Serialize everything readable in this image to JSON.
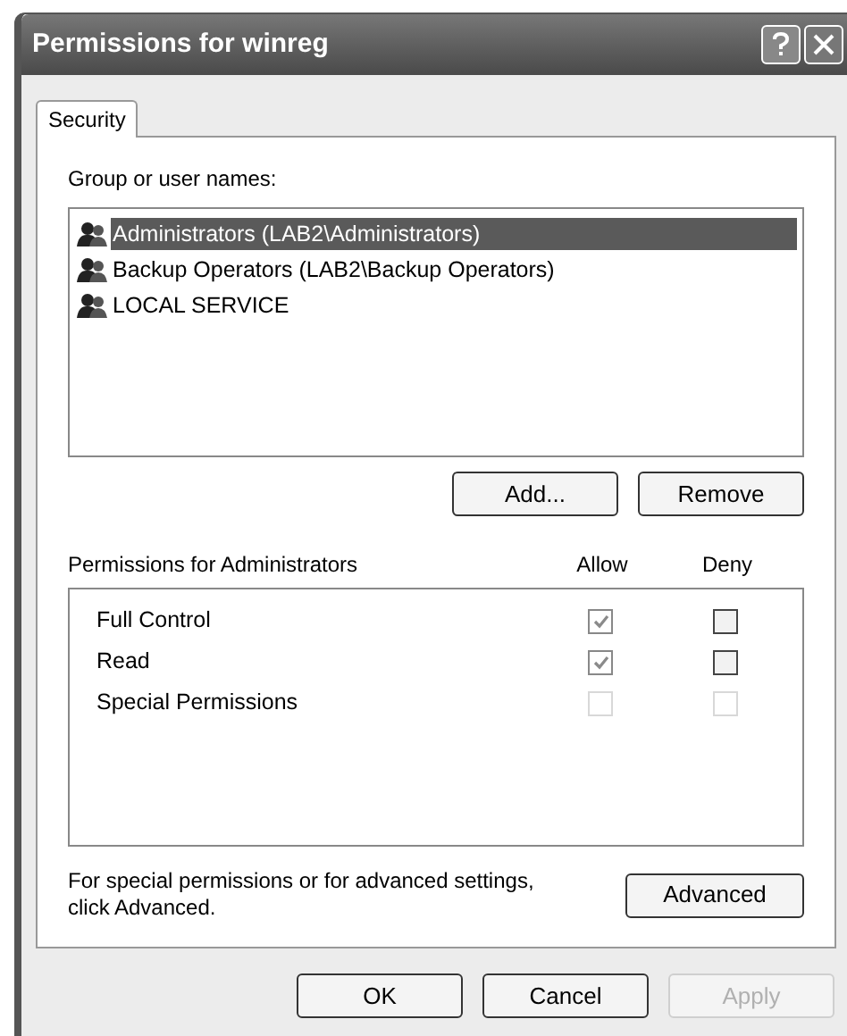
{
  "window": {
    "title": "Permissions for winreg"
  },
  "tabs": [
    {
      "label": "Security",
      "selected": true
    }
  ],
  "group_label": "Group or user names:",
  "users": [
    {
      "name": "Administrators (LAB2\\Administrators)",
      "selected": true
    },
    {
      "name": "Backup Operators (LAB2\\Backup Operators)",
      "selected": false
    },
    {
      "name": "LOCAL SERVICE",
      "selected": false
    }
  ],
  "user_buttons": [
    "Add...",
    "Remove"
  ],
  "permissions": {
    "title": "Permissions for Administrators",
    "columns": [
      "Allow",
      "Deny"
    ],
    "rows": [
      {
        "name": "Full Control",
        "allow": {
          "checked": true,
          "disabled": true
        },
        "deny": {
          "checked": false,
          "disabled": false
        }
      },
      {
        "name": "Read",
        "allow": {
          "checked": true,
          "disabled": true
        },
        "deny": {
          "checked": false,
          "disabled": false
        }
      },
      {
        "name": "Special Permissions",
        "allow": {
          "checked": false,
          "disabled": true
        },
        "deny": {
          "checked": false,
          "disabled": true
        }
      }
    ]
  },
  "advanced_note": "For special permissions or for advanced settings, click Advanced.",
  "advanced_button": "Advanced",
  "buttons": [
    {
      "label": "OK",
      "disabled": false
    },
    {
      "label": "Cancel",
      "disabled": false
    },
    {
      "label": "Apply",
      "disabled": true
    }
  ]
}
